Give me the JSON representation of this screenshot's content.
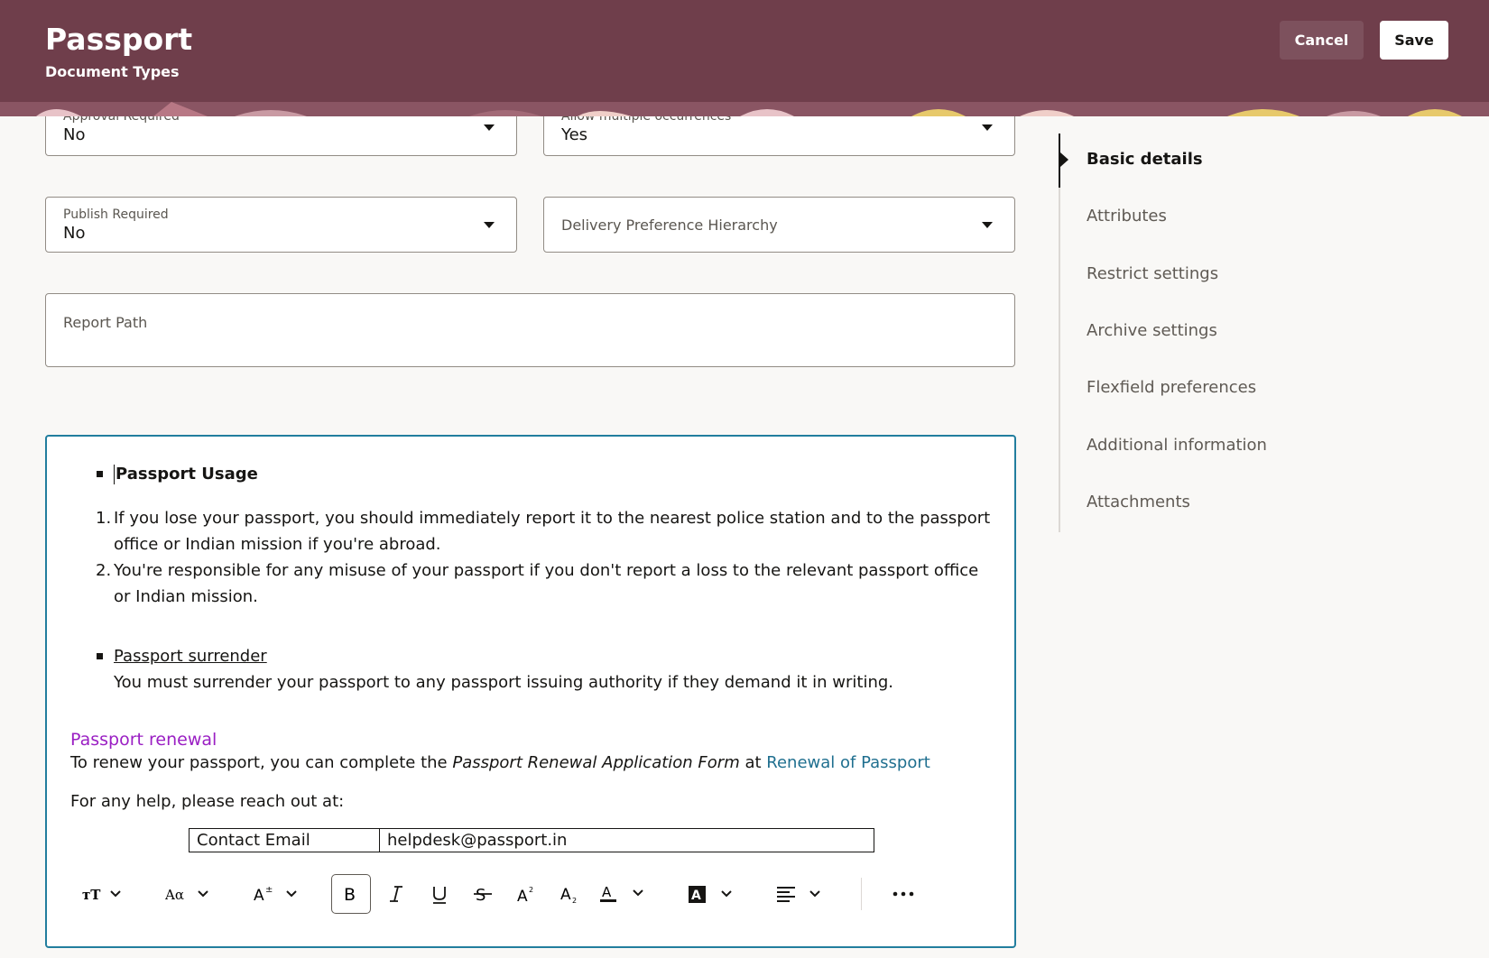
{
  "header": {
    "title": "Passport",
    "subtitle": "Document Types",
    "cancel_label": "Cancel",
    "save_label": "Save",
    "bg_color": "#6f3e4b"
  },
  "form": {
    "approval_required": {
      "label": "Approval Required",
      "value": "No"
    },
    "allow_multiple": {
      "label": "Allow multiple occurrences",
      "value": "Yes"
    },
    "publish_required": {
      "label": "Publish Required",
      "value": "No"
    },
    "delivery_pref": {
      "label": "Delivery Preference Hierarchy"
    },
    "report_path": {
      "label": "Report Path"
    }
  },
  "sidenav": {
    "items": [
      {
        "label": "Basic details",
        "active": true
      },
      {
        "label": "Attributes"
      },
      {
        "label": "Restrict settings"
      },
      {
        "label": "Archive settings"
      },
      {
        "label": "Flexfield preferences"
      },
      {
        "label": "Additional information"
      },
      {
        "label": "Attachments"
      }
    ]
  },
  "editor": {
    "heading_usage": "Passport Usage",
    "list": [
      {
        "num": "1.",
        "line1": "If you lose your passport, you should immediately report it to the nearest police station and to the passport",
        "line2": "office or Indian mission if you're abroad."
      },
      {
        "num": "2.",
        "line1": "You're responsible for any misuse of your passport if you don't report a loss to the relevant passport office",
        "line2": "or Indian mission."
      }
    ],
    "surrender_heading": "Passport surrender",
    "surrender_text": "You must surrender your passport to any passport issuing authority if they demand it in writing.",
    "renewal_heading": "Passport renewal",
    "renewal_text_pre": "To renew your passport, you can complete the ",
    "renewal_form": "Passport Renewal Application Form",
    "renewal_at": " at ",
    "renewal_link": "Renewal of Passport",
    "help_text": "For any help, please reach out at:",
    "contact_label": "Contact Email",
    "contact_value": "helpdesk@passport.in",
    "border_color": "#227e9e",
    "accent_purple": "#9a1fc3"
  },
  "toolbar": {
    "buttons": [
      "text-style-icon",
      "font-family-icon",
      "font-size-icon",
      "bold-icon",
      "italic-icon",
      "underline-icon",
      "strikethrough-icon",
      "superscript-icon",
      "subscript-icon",
      "font-color-icon",
      "highlight-icon",
      "align-icon",
      "more-icon"
    ]
  }
}
